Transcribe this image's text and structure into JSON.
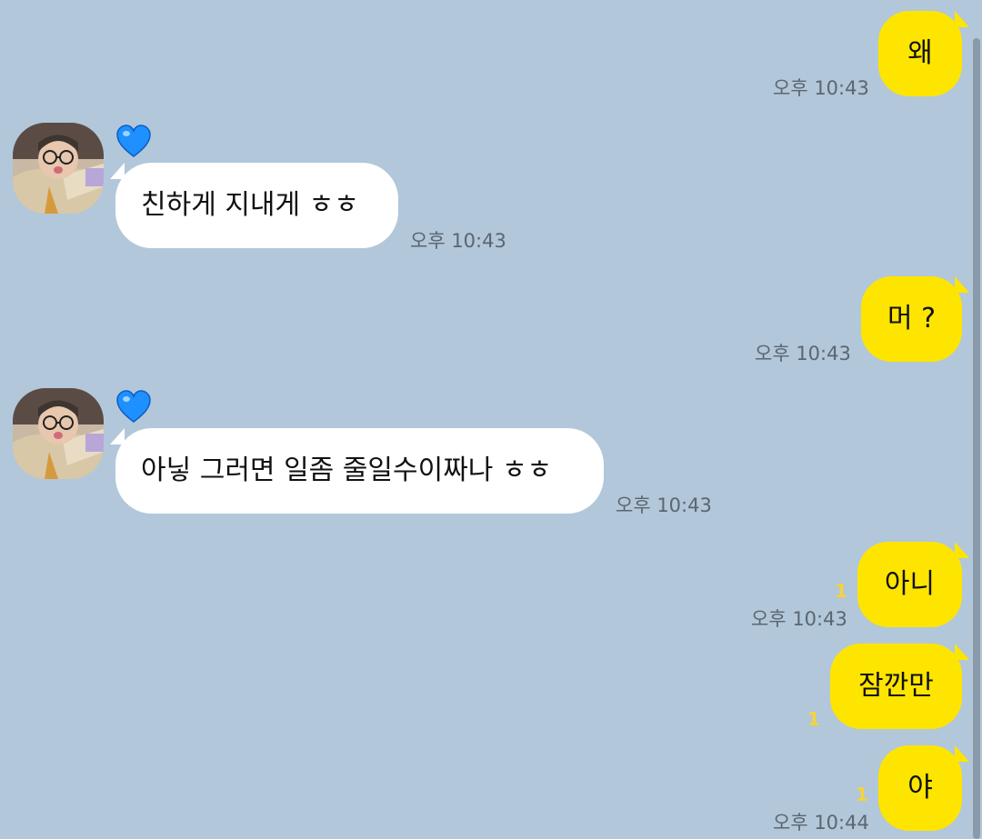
{
  "colors": {
    "background": "#b2c7da",
    "my_bubble": "#fee500",
    "their_bubble": "#ffffff",
    "unread_count": "#f5d33a",
    "timestamp": "#5b6670"
  },
  "contact": {
    "avatar_icon": "profile-photo",
    "badge_icon": "blue-heart-icon"
  },
  "messages": [
    {
      "text": "왜",
      "time": "오후 10:43",
      "unread": ""
    },
    {
      "text": "친하게 지내게 ㅎㅎ",
      "time": "오후 10:43",
      "unread": ""
    },
    {
      "text": "머 ?",
      "time": "오후 10:43",
      "unread": ""
    },
    {
      "text": "아닣 그러면 일좀 줄일수이짜나 ㅎㅎ",
      "time": "오후 10:43",
      "unread": ""
    },
    {
      "text": "아니",
      "time": "오후 10:43",
      "unread": "1"
    },
    {
      "text": "잠깐만",
      "time": "",
      "unread": "1"
    },
    {
      "text": "야",
      "time": "오후 10:44",
      "unread": "1"
    }
  ]
}
